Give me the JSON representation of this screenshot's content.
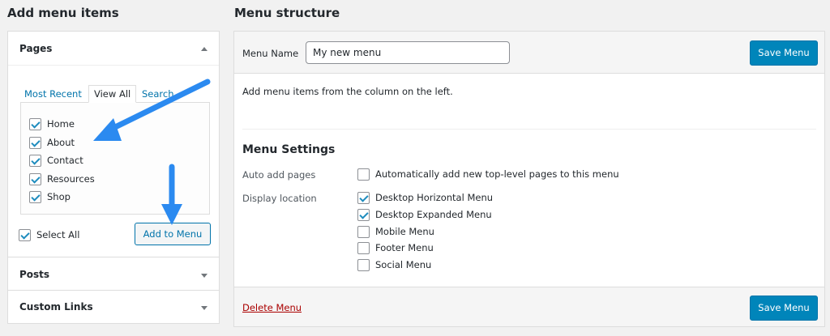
{
  "left_heading": "Add menu items",
  "right_heading": "Menu structure",
  "accordion": {
    "pages": {
      "title": "Pages",
      "tabs": [
        "Most Recent",
        "View All",
        "Search"
      ],
      "active_tab": "View All",
      "items": [
        {
          "label": "Home",
          "checked": true
        },
        {
          "label": "About",
          "checked": true
        },
        {
          "label": "Contact",
          "checked": true
        },
        {
          "label": "Resources",
          "checked": true
        },
        {
          "label": "Shop",
          "checked": true
        }
      ],
      "select_all": {
        "label": "Select All",
        "checked": true
      },
      "add_button": "Add to Menu"
    },
    "posts": {
      "title": "Posts"
    },
    "custom_links": {
      "title": "Custom Links"
    }
  },
  "menu": {
    "name_label": "Menu Name",
    "name_value": "My new menu",
    "save_label": "Save Menu",
    "instructions": "Add menu items from the column on the left.",
    "settings_title": "Menu Settings",
    "auto_add_label": "Auto add pages",
    "auto_add_option": {
      "label": "Automatically add new top-level pages to this menu",
      "checked": false
    },
    "display_location_label": "Display location",
    "locations": [
      {
        "label": "Desktop Horizontal Menu",
        "checked": true
      },
      {
        "label": "Desktop Expanded Menu",
        "checked": true
      },
      {
        "label": "Mobile Menu",
        "checked": false
      },
      {
        "label": "Footer Menu",
        "checked": false
      },
      {
        "label": "Social Menu",
        "checked": false
      }
    ],
    "delete_label": "Delete Menu"
  },
  "colors": {
    "primary_button": "#0085ba",
    "link": "#0073aa",
    "delete_link": "#aa0000",
    "annotation_arrow": "#1e90ff"
  }
}
